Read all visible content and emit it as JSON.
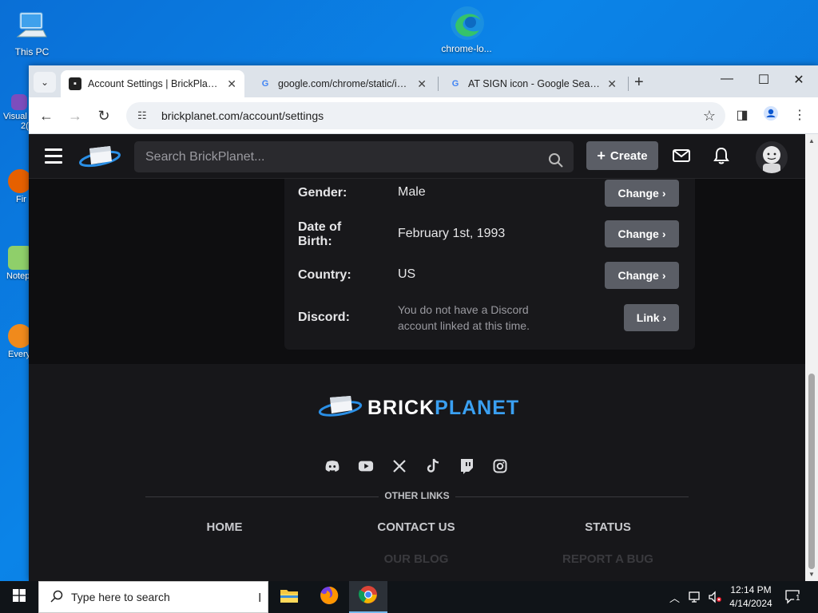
{
  "desktop": {
    "icons": [
      {
        "label": "This PC"
      },
      {
        "label": "chrome-lo..."
      }
    ],
    "left_edge_labels": [
      "Visual",
      "2(",
      "Fir",
      "Notep",
      "Every"
    ]
  },
  "browser": {
    "tabs": [
      {
        "title": "Account Settings | BrickPlanet",
        "active": true
      },
      {
        "title": "google.com/chrome/static/im...",
        "active": false
      },
      {
        "title": "AT SIGN icon - Google Search",
        "active": false
      }
    ],
    "url": "brickplanet.com/account/settings"
  },
  "site": {
    "search_placeholder": "Search BrickPlanet...",
    "create_label": "Create",
    "settings": [
      {
        "label": "Gender:",
        "value": "Male",
        "button": "Change"
      },
      {
        "label": "Date of Birth:",
        "value": "February 1st, 1993",
        "button": "Change"
      },
      {
        "label": "Country:",
        "value": "US",
        "button": "Change"
      },
      {
        "label": "Discord:",
        "value": "You do not have a Discord account linked at this time.",
        "button": "Link"
      }
    ],
    "footer": {
      "brand_part1": "BRICK",
      "brand_part2": "PLANET",
      "other_links_label": "OTHER LINKS",
      "links": [
        "HOME",
        "CONTACT US",
        "STATUS",
        "OUR BLOG",
        "REPORT A BUG"
      ],
      "socials": [
        "discord-icon",
        "youtube-icon",
        "x-icon",
        "tiktok-icon",
        "twitch-icon",
        "instagram-icon"
      ]
    }
  },
  "taskbar": {
    "search_placeholder": "Type here to search",
    "time": "12:14 PM",
    "date": "4/14/2024",
    "notification_count": "1"
  },
  "colors": {
    "accent": "#3aa0f2",
    "button": "#5b5e66",
    "card": "#18181b",
    "page_bg": "#0e0e10"
  }
}
